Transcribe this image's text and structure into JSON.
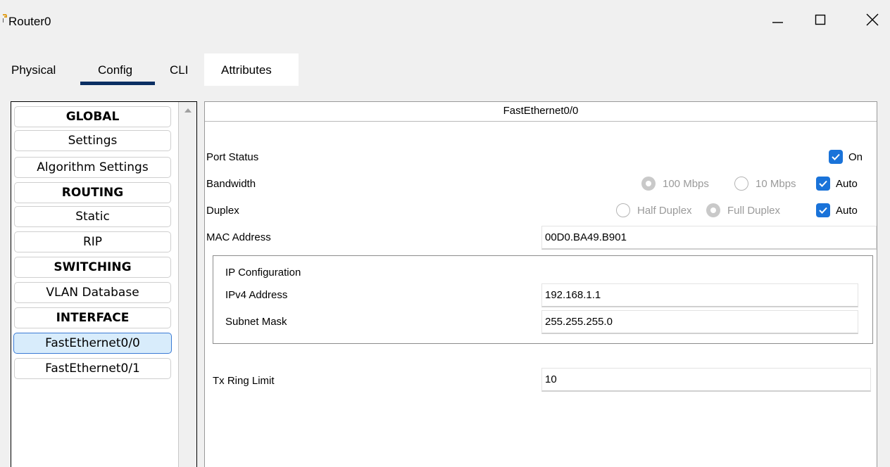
{
  "window": {
    "title": "Router0"
  },
  "tabs": [
    "Physical",
    "Config",
    "CLI",
    "Attributes"
  ],
  "sidebar": {
    "items": [
      {
        "label": "GLOBAL",
        "header": true
      },
      {
        "label": "Settings"
      },
      {
        "label": "Algorithm Settings"
      },
      {
        "label": "ROUTING",
        "header": true
      },
      {
        "label": "Static"
      },
      {
        "label": "RIP"
      },
      {
        "label": "SWITCHING",
        "header": true
      },
      {
        "label": "VLAN Database"
      },
      {
        "label": "INTERFACE",
        "header": true
      },
      {
        "label": "FastEthernet0/0",
        "selected": true
      },
      {
        "label": "FastEthernet0/1"
      }
    ]
  },
  "panel": {
    "title": "FastEthernet0/0",
    "port_status": {
      "label": "Port Status",
      "on_label": "On",
      "on_checked": true
    },
    "bandwidth": {
      "label": "Bandwidth",
      "opt_100": "100 Mbps",
      "opt_10": "10 Mbps",
      "auto": "Auto",
      "selected": "100 Mbps",
      "auto_checked": true
    },
    "duplex": {
      "label": "Duplex",
      "half": "Half Duplex",
      "full": "Full Duplex",
      "auto": "Auto",
      "selected": "Full Duplex",
      "auto_checked": true
    },
    "mac": {
      "label": "MAC Address",
      "value": "00D0.BA49.B901"
    },
    "ip_config": {
      "title": "IP Configuration",
      "ipv4_label": "IPv4 Address",
      "ipv4_value": "192.168.1.1",
      "subnet_label": "Subnet Mask",
      "subnet_value": "255.255.255.0"
    },
    "tx_ring": {
      "label": "Tx Ring Limit",
      "value": "10"
    }
  },
  "colors": {
    "accent": "#1a73d9",
    "tab_underline": "#0b2f63",
    "selected_item": "#d8ecfb"
  }
}
